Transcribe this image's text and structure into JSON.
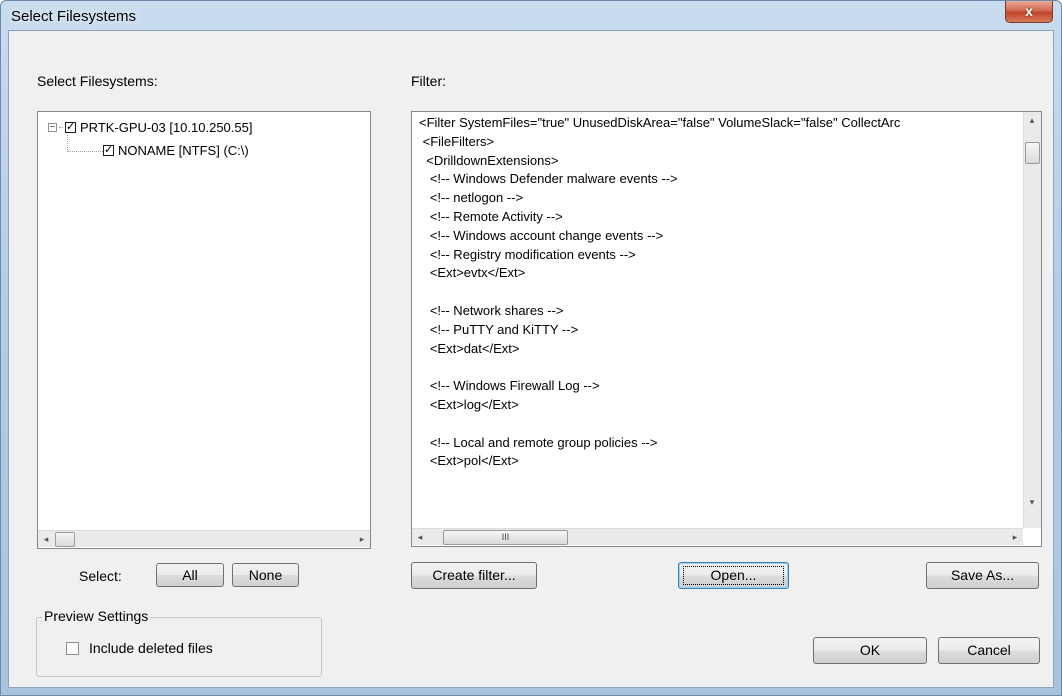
{
  "window": {
    "title": "Select Filesystems",
    "close_glyph": "x"
  },
  "left": {
    "label": "Select Filesystems:",
    "tree": {
      "root": {
        "label": "PRTK-GPU-03 [10.10.250.55]",
        "checked": true,
        "expander": "−"
      },
      "child": {
        "label": "NONAME [NTFS] (C:\\)",
        "checked": true
      }
    },
    "scroll_left_glyph": "◂",
    "scroll_right_glyph": "▸",
    "select_label": "Select:",
    "all_button": "All",
    "none_button": "None",
    "preview": {
      "legend": "Preview Settings",
      "include_deleted_label": "Include deleted files",
      "include_deleted_checked": false
    }
  },
  "right": {
    "label": "Filter:",
    "lines": [
      "<Filter SystemFiles=\"true\" UnusedDiskArea=\"false\" VolumeSlack=\"false\" CollectArc",
      " <FileFilters>",
      "  <DrilldownExtensions>",
      "   <!-- Windows Defender malware events -->",
      "   <!-- netlogon -->",
      "   <!-- Remote Activity -->",
      "   <!-- Windows account change events -->",
      "   <!-- Registry modification events -->",
      "   <Ext>evtx</Ext>",
      "",
      "   <!-- Network shares -->",
      "   <!-- PuTTY and KiTTY -->",
      "   <Ext>dat</Ext>",
      "",
      "   <!-- Windows Firewall Log -->",
      "   <Ext>log</Ext>",
      "",
      "   <!-- Local and remote group policies -->",
      "   <Ext>pol</Ext>"
    ],
    "scroll_up_glyph": "▴",
    "scroll_down_glyph": "▾",
    "scroll_left_glyph": "◂",
    "scroll_right_glyph": "▸",
    "thumb_grip": "III",
    "create_filter_button": "Create filter...",
    "open_button": "Open...",
    "save_as_button": "Save As..."
  },
  "footer": {
    "ok_button": "OK",
    "cancel_button": "Cancel"
  }
}
